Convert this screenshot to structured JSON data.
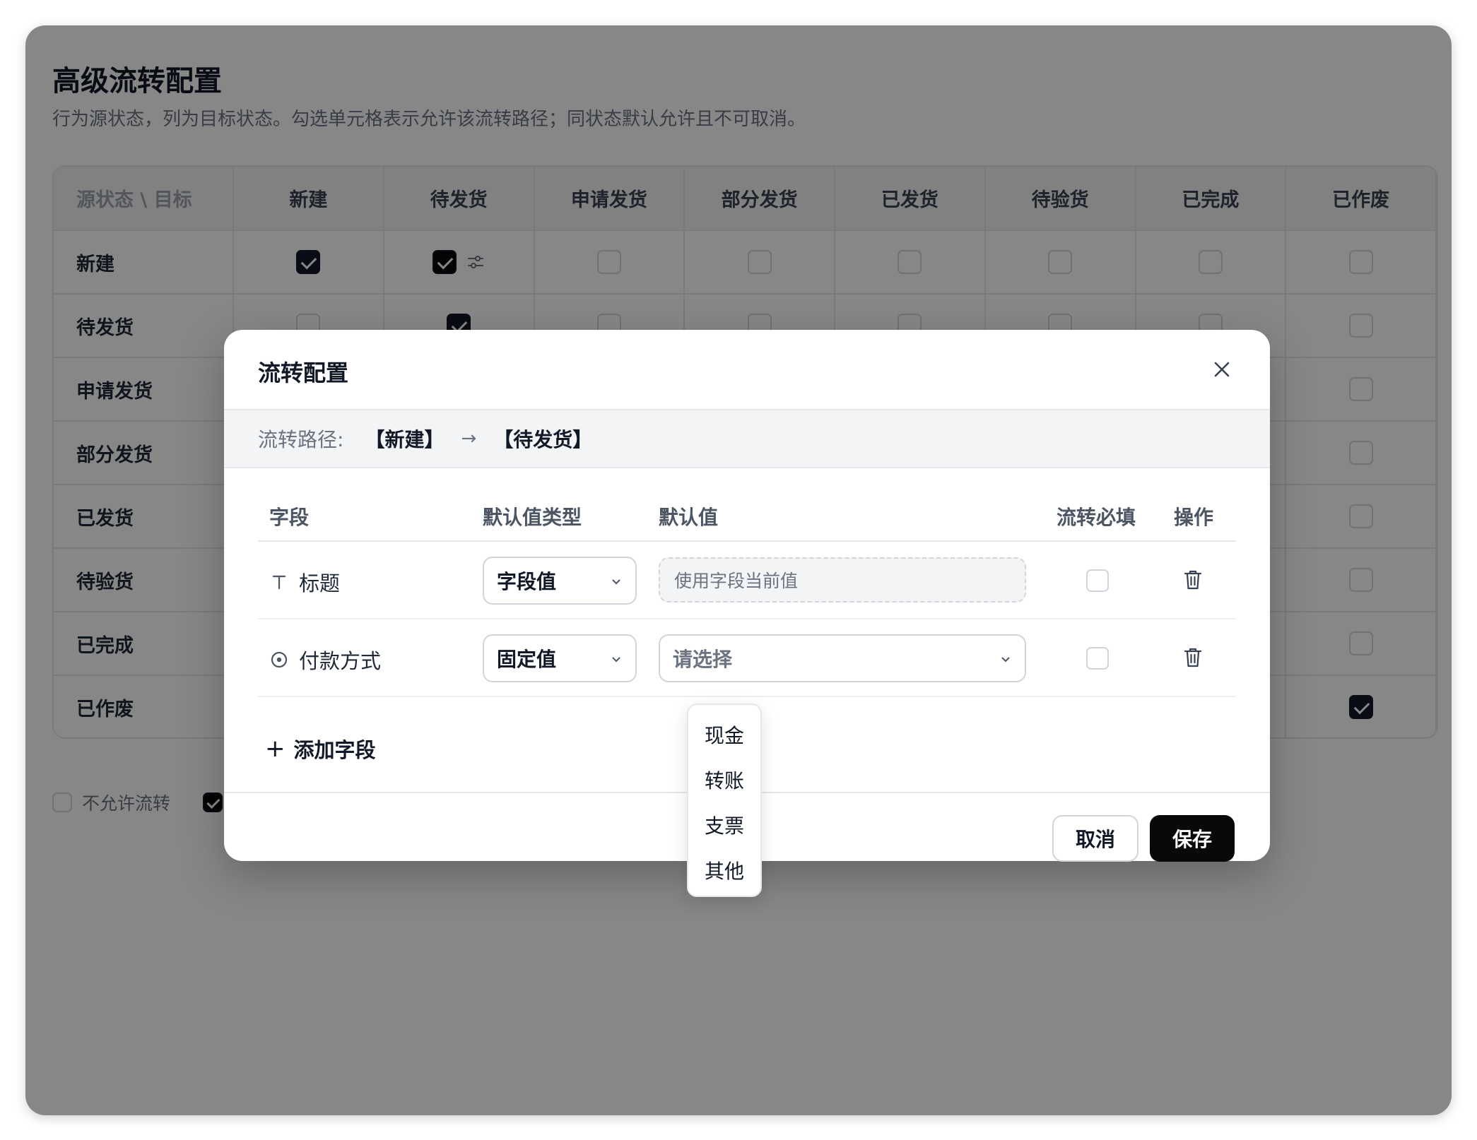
{
  "page": {
    "title": "高级流转配置",
    "description": "行为源状态，列为目标状态。勾选单元格表示允许该流转路径；同状态默认允许且不可取消。"
  },
  "matrix": {
    "corner_label": "源状态 \\ 目标",
    "columns": [
      "新建",
      "待发货",
      "申请发货",
      "部分发货",
      "已发货",
      "待验货",
      "已完成",
      "已作废"
    ],
    "rows": [
      {
        "label": "新建",
        "checked": [
          true,
          true,
          false,
          false,
          false,
          false,
          false,
          false
        ]
      },
      {
        "label": "待发货",
        "checked": [
          false,
          true,
          false,
          false,
          false,
          false,
          false,
          false
        ]
      },
      {
        "label": "申请发货",
        "checked": [
          false,
          false,
          false,
          false,
          false,
          false,
          false,
          false
        ]
      },
      {
        "label": "部分发货",
        "checked": [
          false,
          false,
          false,
          false,
          false,
          false,
          false,
          false
        ]
      },
      {
        "label": "已发货",
        "checked": [
          false,
          false,
          false,
          false,
          false,
          false,
          false,
          false
        ]
      },
      {
        "label": "待验货",
        "checked": [
          false,
          false,
          false,
          false,
          false,
          false,
          false,
          false
        ]
      },
      {
        "label": "已完成",
        "checked": [
          false,
          false,
          false,
          false,
          false,
          false,
          false,
          false
        ]
      },
      {
        "label": "已作废",
        "checked": [
          false,
          false,
          false,
          false,
          false,
          false,
          false,
          true
        ]
      }
    ]
  },
  "legend": {
    "not_allowed_label": "不允许流转"
  },
  "dialog": {
    "title": "流转配置",
    "path_label": "流转路径:",
    "from_state": "【新建】",
    "arrow": "→",
    "to_state": "【待发货】",
    "headers": {
      "field": "字段",
      "default_type": "默认值类型",
      "default_value": "默认值",
      "required": "流转必填",
      "action": "操作"
    },
    "fields": [
      {
        "name": "标题",
        "icon": "text-type-icon",
        "default_type": "字段值",
        "default_value_placeholder": "使用字段当前值",
        "required": false
      },
      {
        "name": "付款方式",
        "icon": "radio-type-icon",
        "default_type": "固定值",
        "default_value_placeholder": "请选择",
        "required": false
      }
    ],
    "add_field_label": "添加字段",
    "cancel_label": "取消",
    "save_label": "保存"
  },
  "dropdown": {
    "options": [
      "现金",
      "转账",
      "支票",
      "其他"
    ]
  }
}
